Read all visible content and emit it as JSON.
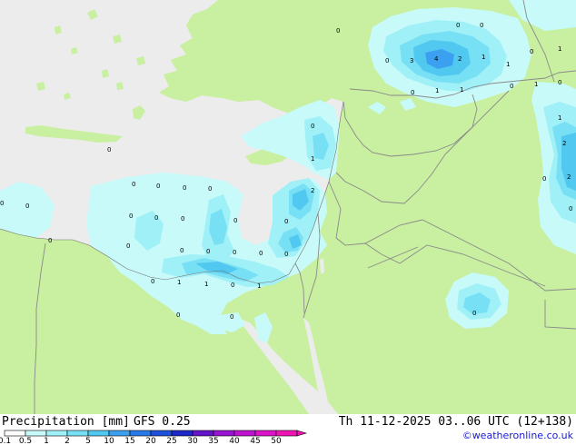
{
  "title": {
    "product": "Precipitation [mm]",
    "model": "GFS 0.25",
    "valid": "Th 11-12-2025 03..06 UTC (12+138)"
  },
  "copyright": "©weatheronline.co.uk",
  "colors": {
    "sea": "#ececec",
    "land": "#c8f0a0",
    "border": "#8a8a8a",
    "coast": "#707070"
  },
  "legend": {
    "ticks": [
      "0.1",
      "0.5",
      "1",
      "2",
      "5",
      "10",
      "15",
      "20",
      "25",
      "30",
      "35",
      "40",
      "45",
      "50"
    ],
    "colors": [
      "#ffffff",
      "#c8fafa",
      "#a0f0f8",
      "#78e0f4",
      "#50c8f0",
      "#3ca0f0",
      "#2878e8",
      "#1e50dc",
      "#1e28c8",
      "#6414c8",
      "#9614d2",
      "#be14d2",
      "#dc14c8",
      "#f014b4"
    ]
  },
  "values": [
    "0",
    "0",
    "0",
    "0",
    "3",
    "4",
    "2",
    "1",
    "0",
    "1",
    "1",
    "0",
    "1",
    "1",
    "1",
    "0",
    "0",
    "1",
    "0",
    "2",
    "0",
    "0",
    "0",
    "0",
    "0",
    "0",
    "0",
    "2",
    "0",
    "0",
    "0",
    "0",
    "0",
    "0",
    "1",
    "0",
    "0",
    "0",
    "0",
    "0",
    "0",
    "1",
    "1",
    "0",
    "1",
    "0",
    "0",
    "0",
    "0",
    "2",
    "0",
    "0"
  ]
}
